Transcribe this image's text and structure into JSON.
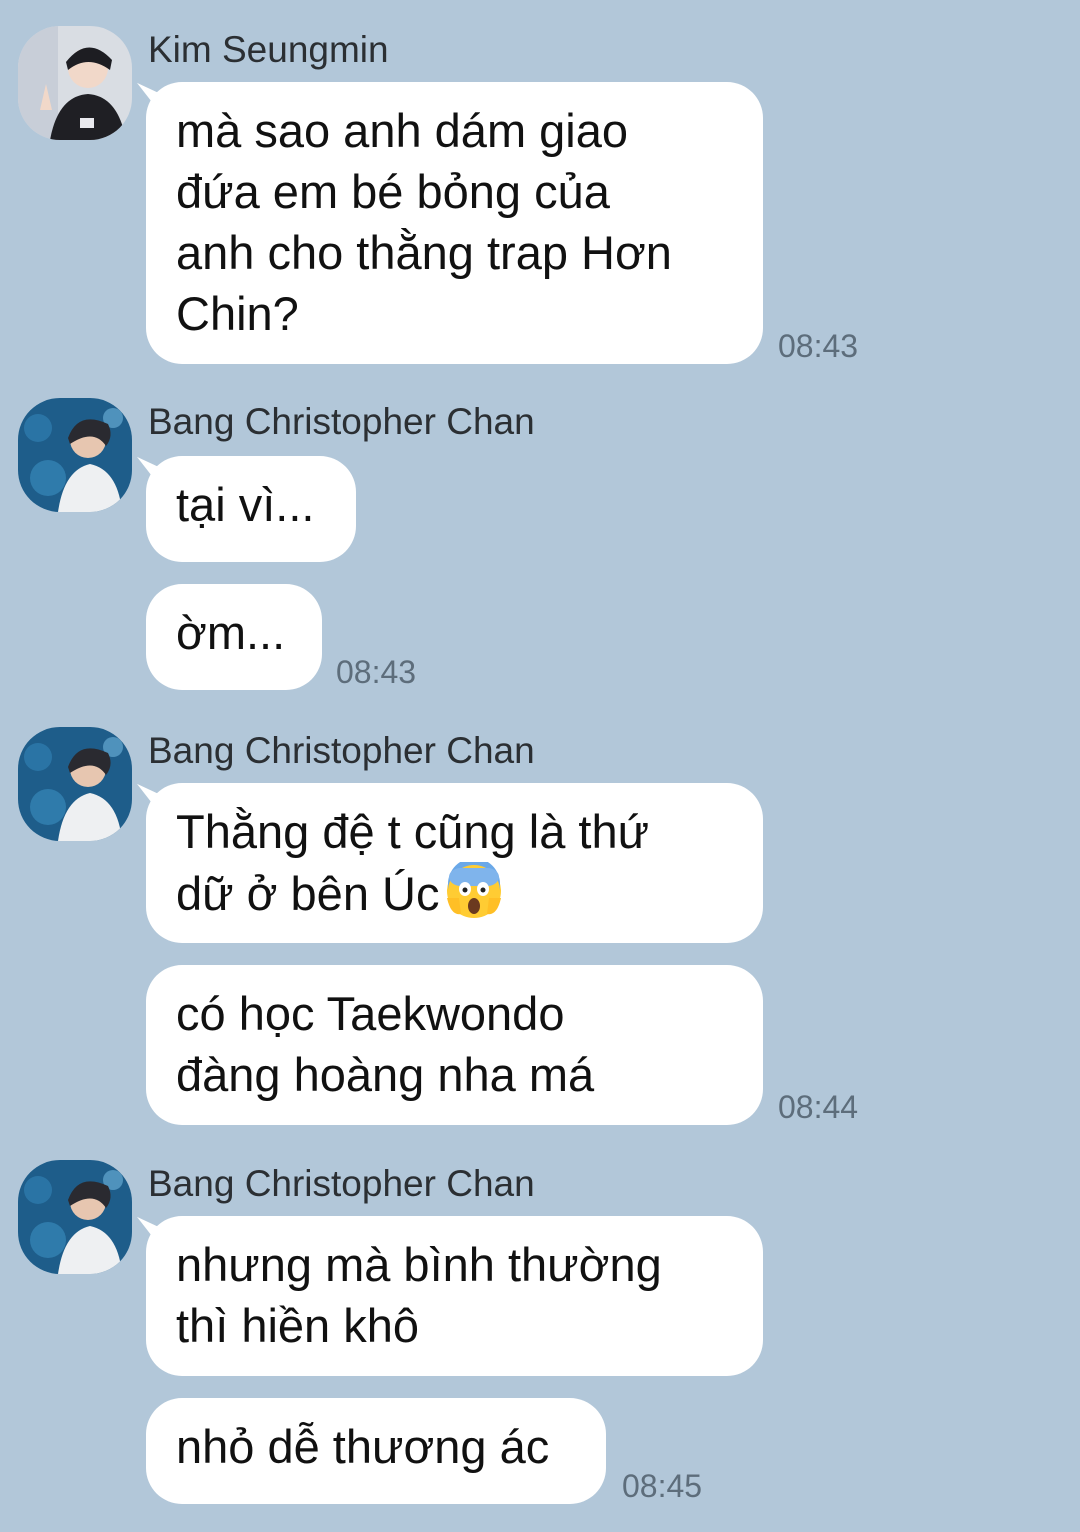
{
  "messages": [
    {
      "sender": "Kim Seungmin",
      "avatar": "avatar-kim-seungmin",
      "bubbles": [
        {
          "lines": [
            "mà sao anh dám giao",
            "đứa em bé bỏng của",
            "anh cho thằng trap Hơn",
            "Chin?"
          ]
        }
      ],
      "time": "08:43"
    },
    {
      "sender": "Bang Christopher Chan",
      "avatar": "avatar-bang-chan",
      "bubbles": [
        {
          "lines": [
            "tại vì..."
          ]
        },
        {
          "lines": [
            "ờm..."
          ]
        }
      ],
      "time": "08:43"
    },
    {
      "sender": "Bang Christopher Chan",
      "avatar": "avatar-bang-chan",
      "bubbles": [
        {
          "lines": [
            "Thằng đệ t cũng là thứ",
            "dữ ở bên Úc"
          ],
          "emoji": "screaming-in-fear-emoji"
        },
        {
          "lines": [
            "có học Taekwondo",
            "đàng hoàng nha má"
          ]
        }
      ],
      "time": "08:44"
    },
    {
      "sender": "Bang Christopher Chan",
      "avatar": "avatar-bang-chan",
      "bubbles": [
        {
          "lines": [
            "nhưng mà bình thường",
            "thì hiền khô"
          ]
        },
        {
          "lines": [
            "nhỏ dễ thương ác"
          ]
        }
      ],
      "time": "08:45"
    }
  ],
  "colors": {
    "background": "#b2c7d9",
    "bubble": "#ffffff",
    "text": "#111111",
    "time": "#5d6d7b"
  }
}
